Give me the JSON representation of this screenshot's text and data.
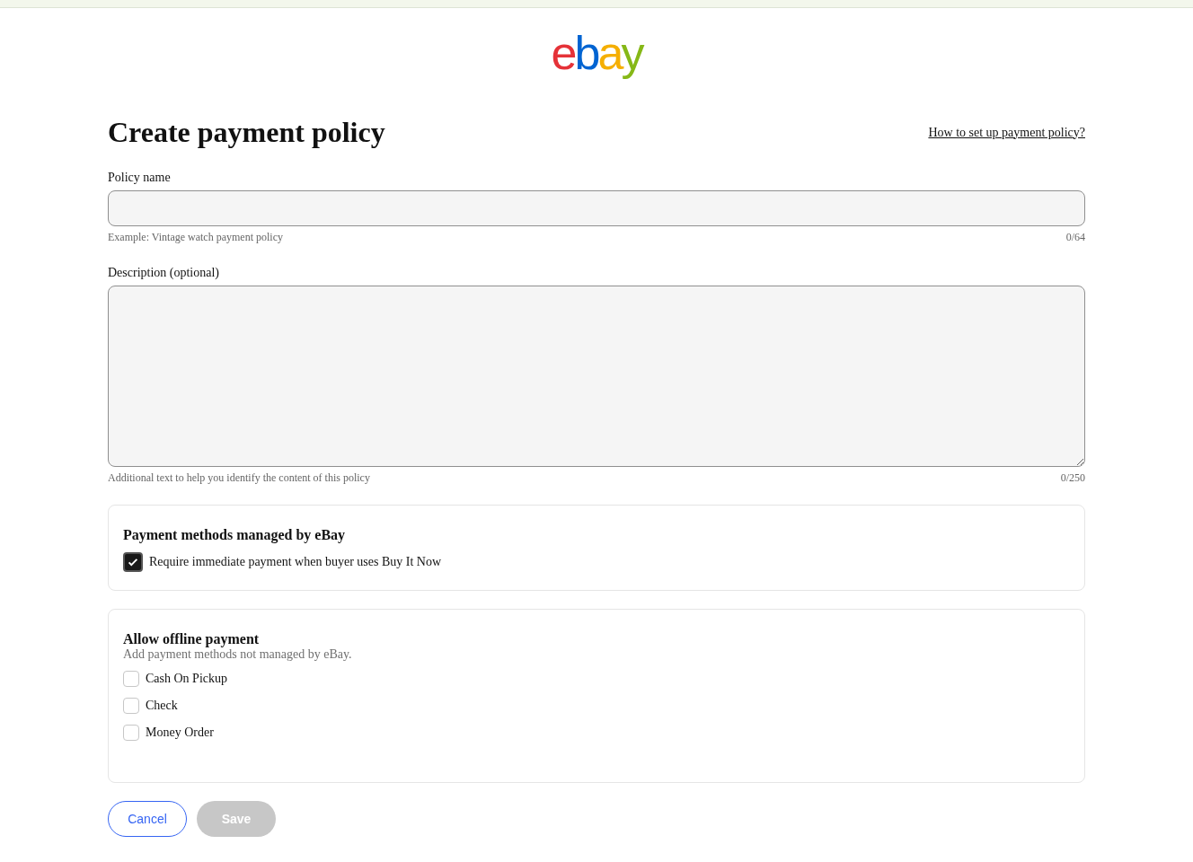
{
  "logo": [
    {
      "text": "e",
      "color": "#e53238"
    },
    {
      "text": "b",
      "color": "#0064d2"
    },
    {
      "text": "a",
      "color": "#f5af02"
    },
    {
      "text": "y",
      "color": "#86b817"
    }
  ],
  "title": "Create payment policy",
  "help_link": "How to set up payment policy?",
  "policy_name": {
    "label": "Policy name",
    "hint": "Example: Vintage watch payment policy",
    "counter": "0/64"
  },
  "description": {
    "label": "Description (optional)",
    "hint": "Additional text to help you identify the content of this policy",
    "counter": "0/250"
  },
  "managed_section": {
    "title": "Payment methods managed by eBay",
    "options": [
      {
        "label": "Require immediate payment when buyer uses Buy It Now",
        "checked": true
      }
    ]
  },
  "offline_section": {
    "title": "Allow offline payment",
    "subtitle": "Add payment methods not managed by eBay.",
    "options": [
      {
        "label": "Cash On Pickup",
        "checked": false
      },
      {
        "label": "Check",
        "checked": false
      },
      {
        "label": "Money Order",
        "checked": false
      }
    ]
  },
  "buttons": [
    {
      "label": "Cancel",
      "kind": "secondary",
      "disabled": false
    },
    {
      "label": "Save",
      "kind": "primary",
      "disabled": true
    }
  ]
}
